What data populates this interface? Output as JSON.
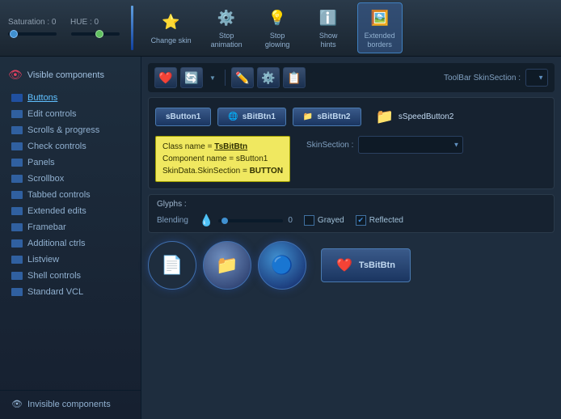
{
  "topbar": {
    "saturation_label": "Saturation : 0",
    "hue_label": "HUE : 0",
    "buttons": [
      {
        "label": "Change\nskin",
        "icon": "🎨",
        "active": false
      },
      {
        "label": "Stop\nanimation",
        "icon": "⚙️",
        "active": false
      },
      {
        "label": "Stop\nglowing",
        "icon": "💡",
        "active": false
      },
      {
        "label": "Show\nhints",
        "icon": "ℹ️",
        "active": false
      },
      {
        "label": "Extended\nborders",
        "icon": "🖼️",
        "active": true
      }
    ]
  },
  "sidebar": {
    "header_label": "Visible components",
    "items": [
      {
        "label": "Buttons",
        "active": true
      },
      {
        "label": "Edit controls",
        "active": false
      },
      {
        "label": "Scrolls & progress",
        "active": false
      },
      {
        "label": "Check controls",
        "active": false
      },
      {
        "label": "Panels",
        "active": false
      },
      {
        "label": "Scrollbox",
        "active": false
      },
      {
        "label": "Tabbed controls",
        "active": false
      },
      {
        "label": "Extended edits",
        "active": false
      },
      {
        "label": "Framebar",
        "active": false
      },
      {
        "label": "Additional ctrls",
        "active": false
      },
      {
        "label": "Listview",
        "active": false
      },
      {
        "label": "Shell controls",
        "active": false
      },
      {
        "label": "Standard VCL",
        "active": false
      }
    ],
    "footer_label": "Invisible components"
  },
  "content": {
    "toolbar_section_label": "ToolBar SkinSection :",
    "demo": {
      "buttons": [
        {
          "label": "sButton1",
          "has_icon": false
        },
        {
          "label": "sBitBtn1",
          "icon": "🌐"
        },
        {
          "label": "sBitBtn2",
          "icon": "📁"
        },
        {
          "label": "sSpeedButton2",
          "icon": "📁",
          "no_border": true
        }
      ],
      "tooltip": {
        "class_line": "Class name = TsBitBtn",
        "component_line": "Component name = sButton1",
        "skin_line": "SkinData.SkinSection = BUTTON"
      },
      "skin_section_label": "SkinSection :",
      "glyphs": {
        "title": "Glyphs :",
        "blending_label": "Blending",
        "blending_value": "0",
        "grayed_label": "Grayed",
        "grayed_checked": false,
        "reflected_label": "Reflected",
        "reflected_checked": true
      },
      "big_buttons": [
        {
          "type": "file",
          "icon": "📄"
        },
        {
          "type": "folder",
          "icon": "📁"
        },
        {
          "type": "dot",
          "icon": "🔵"
        }
      ],
      "tsbitbtn_label": "TsBitBtn"
    }
  }
}
